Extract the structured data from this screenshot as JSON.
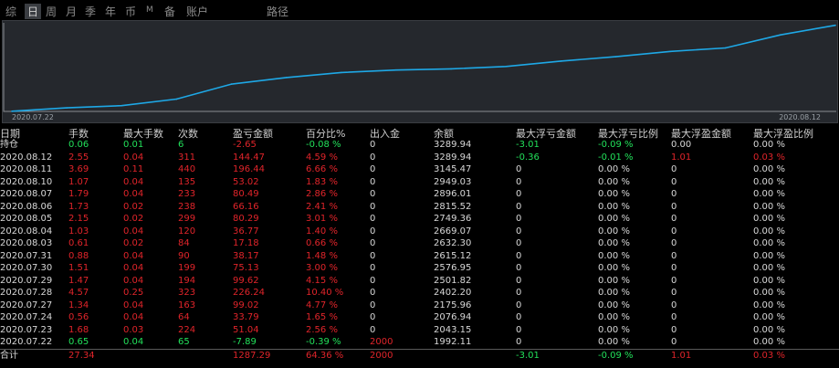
{
  "tabs": [
    {
      "label": "综",
      "active": false,
      "small": false
    },
    {
      "label": "日",
      "active": true,
      "small": false
    },
    {
      "label": "周",
      "active": false,
      "small": false
    },
    {
      "label": "月",
      "active": false,
      "small": false
    },
    {
      "label": "季",
      "active": false,
      "small": false
    },
    {
      "label": "年",
      "active": false,
      "small": false
    },
    {
      "label": "币",
      "active": false,
      "small": false
    },
    {
      "label": "M",
      "active": false,
      "small": true
    },
    {
      "label": "备",
      "active": false,
      "small": false
    },
    {
      "label": "账户",
      "active": false,
      "small": false
    },
    {
      "label": "路径",
      "active": false,
      "small": false
    }
  ],
  "chart_data": {
    "type": "line",
    "x": [
      "2020.07.22",
      "2020.07.23",
      "2020.07.24",
      "2020.07.27",
      "2020.07.28",
      "2020.07.29",
      "2020.07.30",
      "2020.07.31",
      "2020.08.03",
      "2020.08.04",
      "2020.08.05",
      "2020.08.06",
      "2020.08.07",
      "2020.08.10",
      "2020.08.11",
      "2020.08.12"
    ],
    "series": [
      {
        "values": [
          1992.11,
          2043.15,
          2076.94,
          2175.96,
          2402.2,
          2501.82,
          2576.95,
          2615.12,
          2632.3,
          2669.07,
          2749.36,
          2815.52,
          2896.01,
          2949.03,
          3145.47,
          3289.94
        ]
      }
    ],
    "xlabel_start": "2020.07.22",
    "xlabel_end": "2020.08.12",
    "line_color": "#1ea8e6",
    "grid": false
  },
  "columns": [
    "日期",
    "手数",
    "最大手数",
    "次数",
    "盈亏金额",
    "百分比%",
    "出入金",
    "余额",
    "最大浮亏金额",
    "最大浮亏比例",
    "最大浮盈金额",
    "最大浮盈比例"
  ],
  "rows": [
    {
      "c": [
        "持仓",
        "0.06",
        "0.01",
        "6",
        "-2.65",
        "-0.08 %",
        "0",
        "3289.94",
        "-3.01",
        "-0.09 %",
        "0.00",
        "0.00 %"
      ],
      "k": [
        "w",
        "g",
        "g",
        "g",
        "r",
        "g",
        "w",
        "w",
        "g",
        "g",
        "w",
        "w"
      ]
    },
    {
      "c": [
        "2020.08.12",
        "2.55",
        "0.04",
        "311",
        "144.47",
        "4.59 %",
        "0",
        "3289.94",
        "-0.36",
        "-0.01 %",
        "1.01",
        "0.03 %"
      ],
      "k": [
        "w",
        "r",
        "r",
        "r",
        "r",
        "r",
        "w",
        "w",
        "g",
        "g",
        "r",
        "r"
      ]
    },
    {
      "c": [
        "2020.08.11",
        "3.69",
        "0.11",
        "440",
        "196.44",
        "6.66 %",
        "0",
        "3145.47",
        "0",
        "0.00 %",
        "0",
        "0.00 %"
      ],
      "k": [
        "w",
        "r",
        "r",
        "r",
        "r",
        "r",
        "w",
        "w",
        "w",
        "w",
        "w",
        "w"
      ]
    },
    {
      "c": [
        "2020.08.10",
        "1.07",
        "0.04",
        "135",
        "53.02",
        "1.83 %",
        "0",
        "2949.03",
        "0",
        "0.00 %",
        "0",
        "0.00 %"
      ],
      "k": [
        "w",
        "r",
        "r",
        "r",
        "r",
        "r",
        "w",
        "w",
        "w",
        "w",
        "w",
        "w"
      ]
    },
    {
      "c": [
        "2020.08.07",
        "1.79",
        "0.04",
        "233",
        "80.49",
        "2.86 %",
        "0",
        "2896.01",
        "0",
        "0.00 %",
        "0",
        "0.00 %"
      ],
      "k": [
        "w",
        "r",
        "r",
        "r",
        "r",
        "r",
        "w",
        "w",
        "w",
        "w",
        "w",
        "w"
      ]
    },
    {
      "c": [
        "2020.08.06",
        "1.73",
        "0.02",
        "238",
        "66.16",
        "2.41 %",
        "0",
        "2815.52",
        "0",
        "0.00 %",
        "0",
        "0.00 %"
      ],
      "k": [
        "w",
        "r",
        "r",
        "r",
        "r",
        "r",
        "w",
        "w",
        "w",
        "w",
        "w",
        "w"
      ]
    },
    {
      "c": [
        "2020.08.05",
        "2.15",
        "0.02",
        "299",
        "80.29",
        "3.01 %",
        "0",
        "2749.36",
        "0",
        "0.00 %",
        "0",
        "0.00 %"
      ],
      "k": [
        "w",
        "r",
        "r",
        "r",
        "r",
        "r",
        "w",
        "w",
        "w",
        "w",
        "w",
        "w"
      ]
    },
    {
      "c": [
        "2020.08.04",
        "1.03",
        "0.04",
        "120",
        "36.77",
        "1.40 %",
        "0",
        "2669.07",
        "0",
        "0.00 %",
        "0",
        "0.00 %"
      ],
      "k": [
        "w",
        "r",
        "r",
        "r",
        "r",
        "r",
        "w",
        "w",
        "w",
        "w",
        "w",
        "w"
      ]
    },
    {
      "c": [
        "2020.08.03",
        "0.61",
        "0.02",
        "84",
        "17.18",
        "0.66 %",
        "0",
        "2632.30",
        "0",
        "0.00 %",
        "0",
        "0.00 %"
      ],
      "k": [
        "w",
        "r",
        "r",
        "r",
        "r",
        "r",
        "w",
        "w",
        "w",
        "w",
        "w",
        "w"
      ]
    },
    {
      "c": [
        "2020.07.31",
        "0.88",
        "0.04",
        "90",
        "38.17",
        "1.48 %",
        "0",
        "2615.12",
        "0",
        "0.00 %",
        "0",
        "0.00 %"
      ],
      "k": [
        "w",
        "r",
        "r",
        "r",
        "r",
        "r",
        "w",
        "w",
        "w",
        "w",
        "w",
        "w"
      ]
    },
    {
      "c": [
        "2020.07.30",
        "1.51",
        "0.04",
        "199",
        "75.13",
        "3.00 %",
        "0",
        "2576.95",
        "0",
        "0.00 %",
        "0",
        "0.00 %"
      ],
      "k": [
        "w",
        "r",
        "r",
        "r",
        "r",
        "r",
        "w",
        "w",
        "w",
        "w",
        "w",
        "w"
      ]
    },
    {
      "c": [
        "2020.07.29",
        "1.47",
        "0.04",
        "194",
        "99.62",
        "4.15 %",
        "0",
        "2501.82",
        "0",
        "0.00 %",
        "0",
        "0.00 %"
      ],
      "k": [
        "w",
        "r",
        "r",
        "r",
        "r",
        "r",
        "w",
        "w",
        "w",
        "w",
        "w",
        "w"
      ]
    },
    {
      "c": [
        "2020.07.28",
        "4.57",
        "0.25",
        "323",
        "226.24",
        "10.40 %",
        "0",
        "2402.20",
        "0",
        "0.00 %",
        "0",
        "0.00 %"
      ],
      "k": [
        "w",
        "r",
        "r",
        "r",
        "r",
        "r",
        "w",
        "w",
        "w",
        "w",
        "w",
        "w"
      ]
    },
    {
      "c": [
        "2020.07.27",
        "1.34",
        "0.04",
        "163",
        "99.02",
        "4.77 %",
        "0",
        "2175.96",
        "0",
        "0.00 %",
        "0",
        "0.00 %"
      ],
      "k": [
        "w",
        "r",
        "r",
        "r",
        "r",
        "r",
        "w",
        "w",
        "w",
        "w",
        "w",
        "w"
      ]
    },
    {
      "c": [
        "2020.07.24",
        "0.56",
        "0.04",
        "64",
        "33.79",
        "1.65 %",
        "0",
        "2076.94",
        "0",
        "0.00 %",
        "0",
        "0.00 %"
      ],
      "k": [
        "w",
        "r",
        "r",
        "r",
        "r",
        "r",
        "w",
        "w",
        "w",
        "w",
        "w",
        "w"
      ]
    },
    {
      "c": [
        "2020.07.23",
        "1.68",
        "0.03",
        "224",
        "51.04",
        "2.56 %",
        "0",
        "2043.15",
        "0",
        "0.00 %",
        "0",
        "0.00 %"
      ],
      "k": [
        "w",
        "r",
        "r",
        "r",
        "r",
        "r",
        "w",
        "w",
        "w",
        "w",
        "w",
        "w"
      ]
    },
    {
      "c": [
        "2020.07.22",
        "0.65",
        "0.04",
        "65",
        "-7.89",
        "-0.39 %",
        "2000",
        "1992.11",
        "0",
        "0.00 %",
        "0",
        "0.00 %"
      ],
      "k": [
        "w",
        "g",
        "g",
        "g",
        "g",
        "g",
        "r",
        "w",
        "w",
        "w",
        "w",
        "w"
      ]
    }
  ],
  "total": {
    "c": [
      "合计",
      "27.34",
      "",
      "",
      "1287.29",
      "64.36 %",
      "2000",
      "",
      "-3.01",
      "-0.09 %",
      "1.01",
      "0.03 %"
    ],
    "k": [
      "w",
      "r",
      "w",
      "w",
      "r",
      "r",
      "r",
      "w",
      "g",
      "g",
      "r",
      "r"
    ]
  },
  "colors": {
    "red": "#e0242a",
    "green": "#22e05a",
    "white": "#d8d8d8",
    "chart_bg": "#25282d",
    "line": "#1ea8e6"
  }
}
